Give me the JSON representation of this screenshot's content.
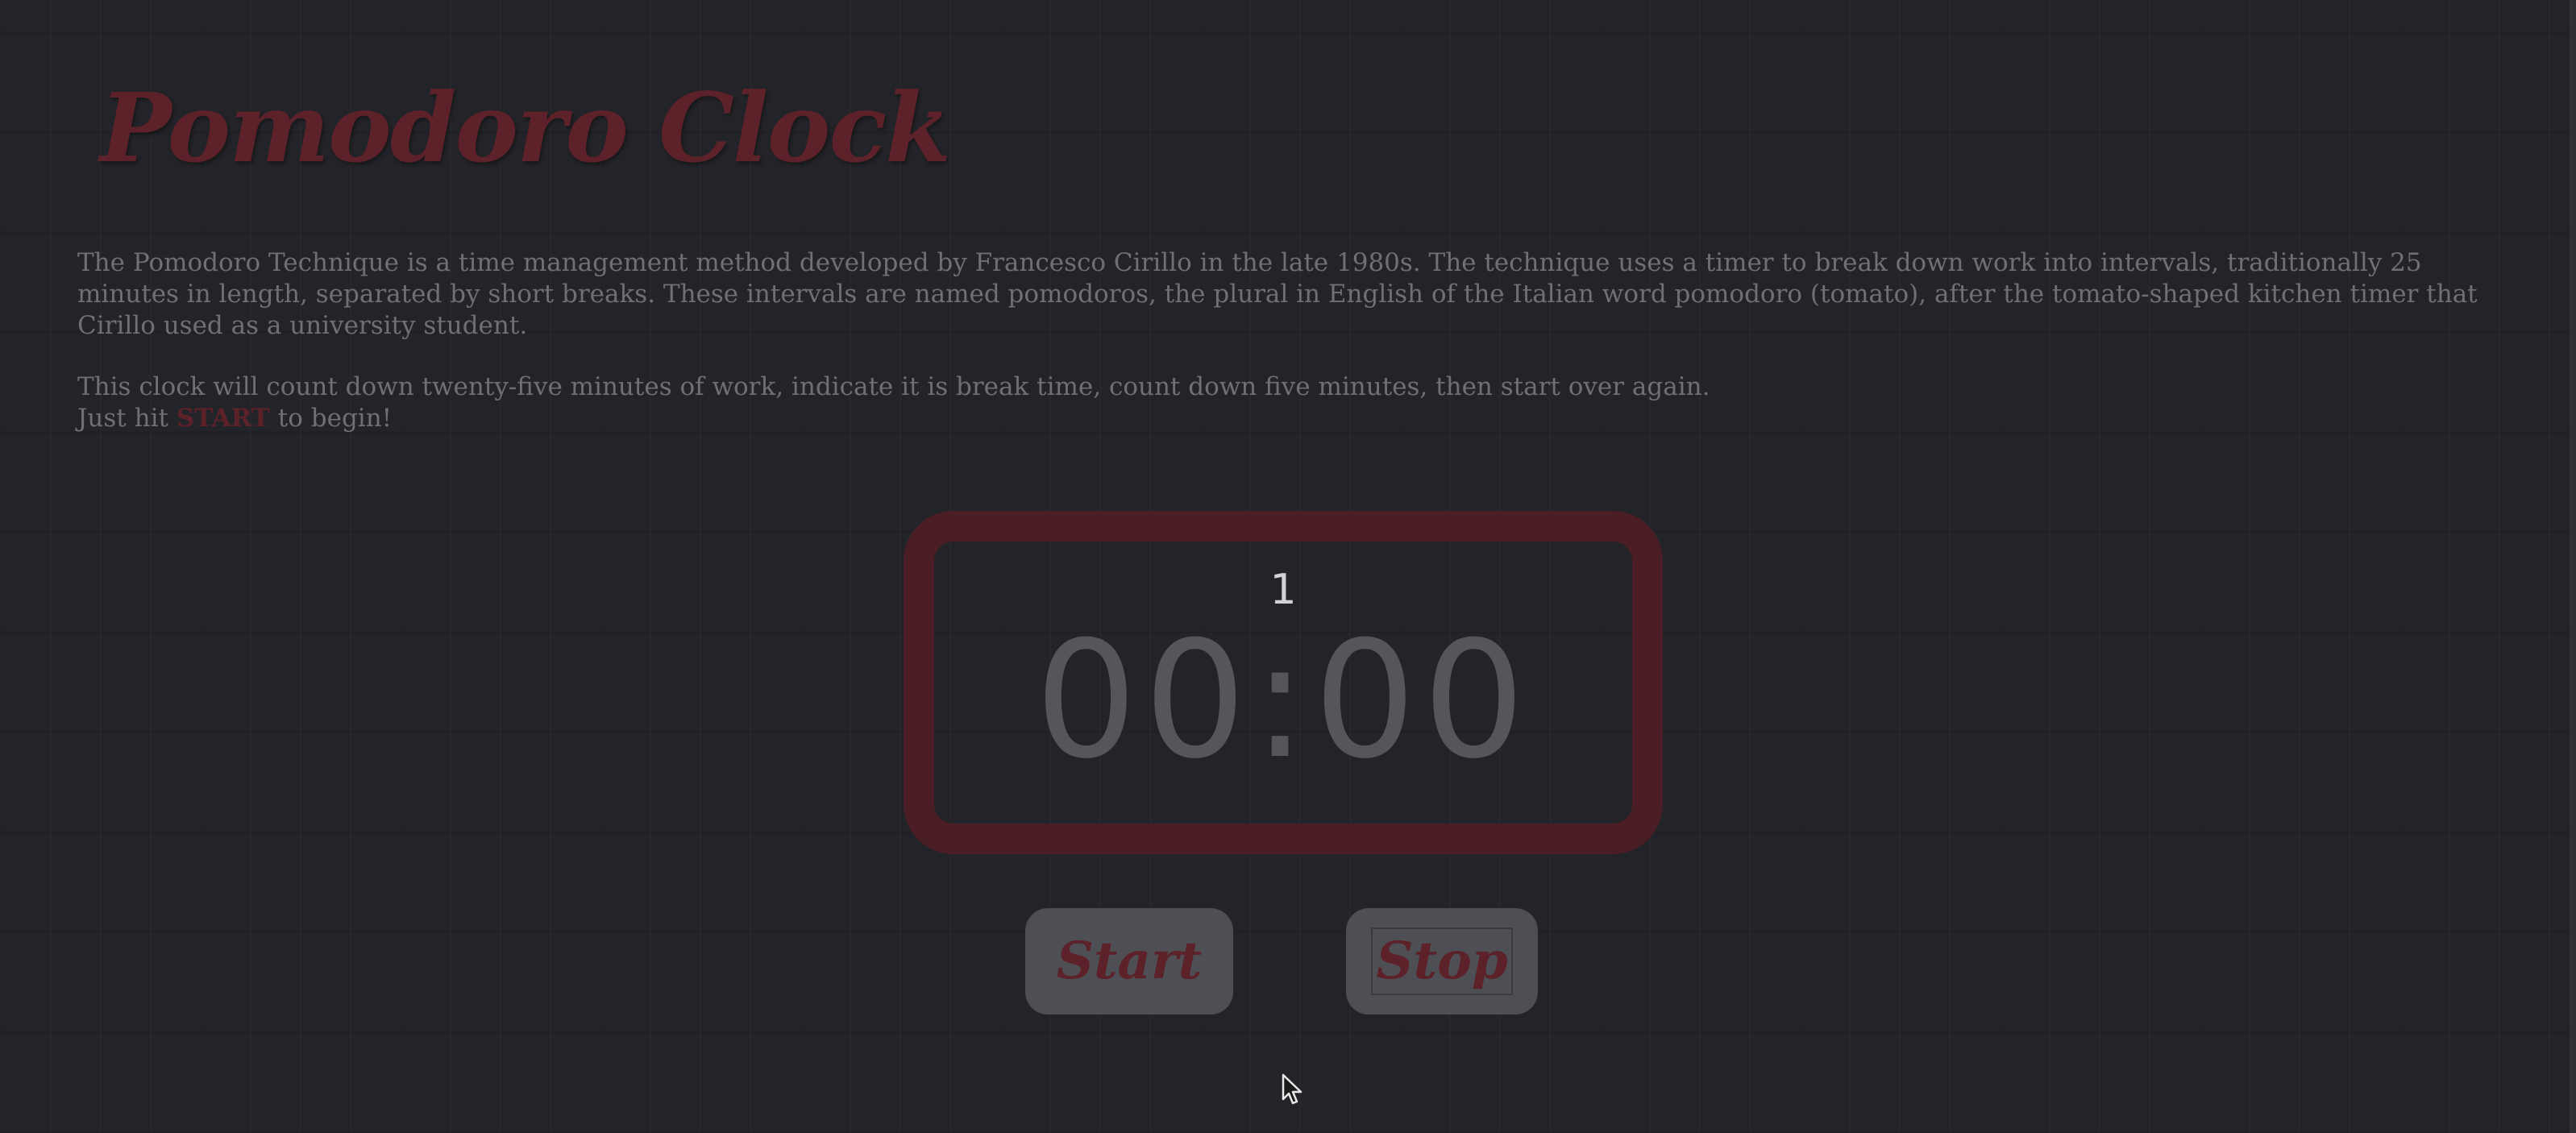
{
  "page": {
    "title": "Pomodoro Clock"
  },
  "intro": {
    "paragraph1": "The Pomodoro Technique is a time management method developed by Francesco Cirillo in the late 1980s. The technique uses a timer to break down work into intervals, traditionally 25 minutes in length, separated by short breaks. These intervals are named pomodoros, the plural in English of the Italian word pomodoro (tomato), after the tomato-shaped kitchen timer that Cirillo used as a university student.",
    "line2": "This clock will count down twenty-five minutes of work, indicate it is break time, count down five minutes, then start over again.",
    "line3_prefix": "Just hit ",
    "line3_emphasis": "START",
    "line3_suffix": " to begin!"
  },
  "clock": {
    "session_count": "1",
    "time": "00:00"
  },
  "controls": {
    "start_label": "Start",
    "stop_label": "Stop"
  },
  "colors": {
    "background": "#232429",
    "accent": "#5c2129",
    "clock_border": "#4b1d25",
    "button_bg": "#4e4f55",
    "body_text": "#6f7076"
  }
}
